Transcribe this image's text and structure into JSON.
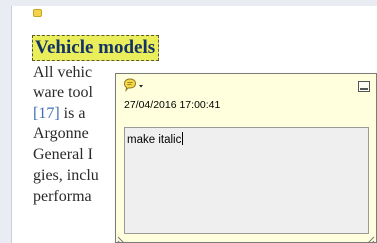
{
  "document": {
    "heading": "Vehicle models",
    "lines": [
      {
        "before": "All vehic",
        "ref": "",
        "after": ""
      },
      {
        "before": "ware tool",
        "ref": "",
        "after": ""
      },
      {
        "before": "",
        "ref": "[17]",
        "after": " is  a"
      },
      {
        "before": "Argonne",
        "ref": "",
        "after": ""
      },
      {
        "before": "General I",
        "ref": "",
        "after": ""
      },
      {
        "before": "gies, inclu",
        "ref": "",
        "after": ""
      },
      {
        "before": "performa",
        "ref": "",
        "after": ""
      }
    ]
  },
  "popup": {
    "icon": "speech-bubble-icon",
    "date": "27/04/2016 17:00:41",
    "text": "make italic"
  },
  "colors": {
    "highlight": "#e9ee5a",
    "heading_text": "#143266",
    "popup_background": "#ffffde",
    "reference_link": "#3e6fb4"
  }
}
